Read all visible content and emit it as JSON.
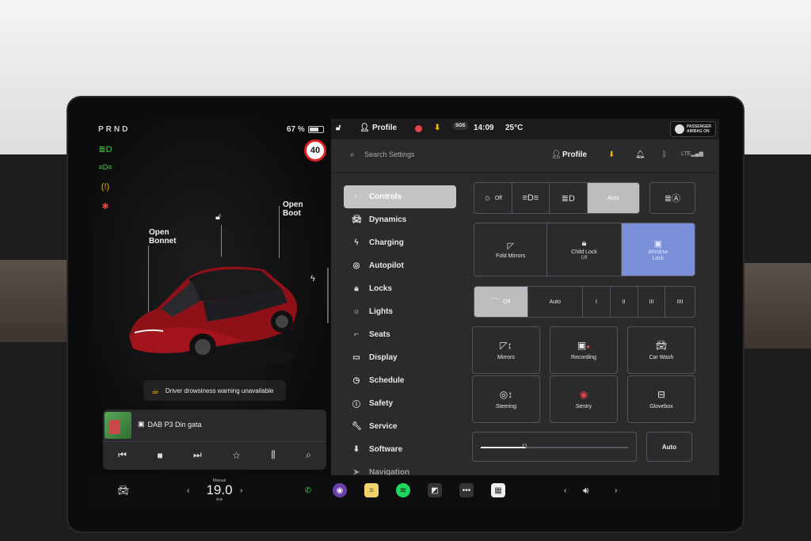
{
  "left": {
    "gear_indicator": "PRND",
    "battery_percent": "67 %",
    "battery_level": 0.67,
    "speed_limit": "40",
    "labels": {
      "bonnet": [
        "Open",
        "Bonnet"
      ],
      "boot": [
        "Open",
        "Boot"
      ]
    },
    "warning": "Driver drowsiness warning unavailable",
    "media": {
      "station": "DAB P3 Din gata"
    }
  },
  "status_bar": {
    "profile": "Profile",
    "sos": "SOS",
    "time": "14:09",
    "temperature": "25°C",
    "airbag": [
      "PASSENGER",
      "AIRBAG ON"
    ]
  },
  "settings": {
    "search_placeholder": "Search Settings",
    "profile": "Profile",
    "nav": [
      {
        "label": "Controls",
        "icon": "toggle-icon",
        "active": true
      },
      {
        "label": "Dynamics",
        "icon": "car-icon"
      },
      {
        "label": "Charging",
        "icon": "bolt-icon"
      },
      {
        "label": "Autopilot",
        "icon": "steering-wheel-icon"
      },
      {
        "label": "Locks",
        "icon": "lock-icon"
      },
      {
        "label": "Lights",
        "icon": "sun-icon"
      },
      {
        "label": "Seats",
        "icon": "seat-icon"
      },
      {
        "label": "Display",
        "icon": "display-icon"
      },
      {
        "label": "Schedule",
        "icon": "clock-icon"
      },
      {
        "label": "Safety",
        "icon": "alert-icon"
      },
      {
        "label": "Service",
        "icon": "wrench-icon"
      },
      {
        "label": "Software",
        "icon": "download-icon"
      },
      {
        "label": "Navigation",
        "icon": "navigation-icon"
      }
    ],
    "lights": {
      "off": "Off",
      "auto": "Auto"
    },
    "quick": {
      "fold_mirrors": "Fold Mirrors",
      "child_lock": "Child Lock",
      "child_lock_state": "Off",
      "window_lock": "Window",
      "window_lock_2": "Lock"
    },
    "wipers": {
      "off": "Off",
      "auto": "Auto",
      "speeds": [
        "I",
        "II",
        "III",
        "IIII"
      ]
    },
    "grid": {
      "mirrors": "Mirrors",
      "recording": "Recording",
      "car_wash": "Car Wash",
      "steering": "Steering",
      "sentry": "Sentry",
      "glovebox": "Glovebox"
    },
    "brightness_level": 0.3,
    "brightness_auto": "Auto"
  },
  "dock": {
    "temp_mode": "Manual",
    "temp_value": "19.0"
  },
  "colors": {
    "active_blue": "#7a8fd8",
    "record_red": "#e04444",
    "download_yellow": "#f0b400"
  }
}
